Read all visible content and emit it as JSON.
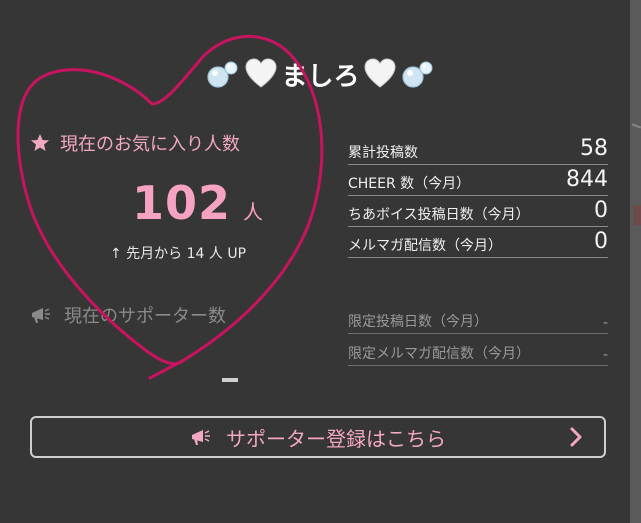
{
  "title": {
    "name": "ましろ",
    "left_emoji_1": "bubbles-icon",
    "left_emoji_2": "white-heart-icon",
    "right_emoji_1": "white-heart-icon",
    "right_emoji_2": "bubbles-icon"
  },
  "favorites": {
    "heading": "現在のお気に入り人数",
    "count": "102",
    "unit": "人",
    "delta": "↑ 先月から 14 人 UP"
  },
  "supporters": {
    "heading": "現在のサポーター数",
    "value": "-"
  },
  "stats_top": [
    {
      "label": "累計投稿数",
      "value": "58"
    },
    {
      "label": "CHEER 数（今月）",
      "value": "844"
    },
    {
      "label": "ちあボイス投稿日数（今月）",
      "value": "0"
    },
    {
      "label": "メルマガ配信数（今月）",
      "value": "0"
    }
  ],
  "stats_bottom": [
    {
      "label": "限定投稿日数（今月）",
      "value": "-"
    },
    {
      "label": "限定メルマガ配信数（今月）",
      "value": "-"
    }
  ],
  "cta": {
    "label": "サポーター登録はこちら"
  },
  "colors": {
    "accent_pink": "#f2a7c3",
    "annotation_magenta": "#c8145f",
    "background": "#363636"
  }
}
